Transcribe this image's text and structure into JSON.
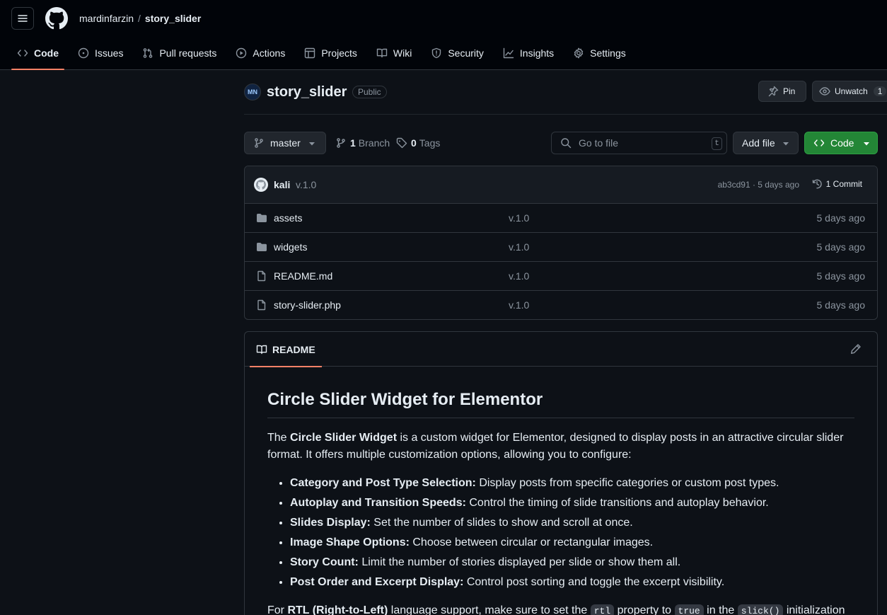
{
  "header": {
    "owner": "mardinfarzin",
    "separator": "/",
    "repo": "story_slider"
  },
  "nav": {
    "tabs": [
      {
        "label": "Code",
        "icon": "code-icon",
        "active": true
      },
      {
        "label": "Issues",
        "icon": "issue-icon"
      },
      {
        "label": "Pull requests",
        "icon": "pull-request-icon"
      },
      {
        "label": "Actions",
        "icon": "play-icon"
      },
      {
        "label": "Projects",
        "icon": "table-icon"
      },
      {
        "label": "Wiki",
        "icon": "book-icon"
      },
      {
        "label": "Security",
        "icon": "shield-icon"
      },
      {
        "label": "Insights",
        "icon": "graph-icon"
      },
      {
        "label": "Settings",
        "icon": "gear-icon"
      }
    ]
  },
  "repo_head": {
    "name": "story_slider",
    "org_avatar": "MN",
    "visibility": "Public",
    "pin_label": "Pin",
    "unwatch_label": "Unwatch",
    "watch_count": "1"
  },
  "toolbar": {
    "branch": "master",
    "branch_count": "1",
    "branch_label": "Branch",
    "tag_count": "0",
    "tag_label": "Tags",
    "goto_placeholder": "Go to file",
    "goto_key": "t",
    "add_file": "Add file",
    "code": "Code"
  },
  "commit": {
    "user": "kali",
    "message": "v.1.0",
    "hash_time": "ab3cd91 · 5 days ago",
    "count": "1 Commit"
  },
  "files": [
    {
      "name": "assets",
      "type": "folder",
      "message": "v.1.0",
      "date": "5 days ago"
    },
    {
      "name": "widgets",
      "type": "folder",
      "message": "v.1.0",
      "date": "5 days ago"
    },
    {
      "name": "README.md",
      "type": "file",
      "message": "v.1.0",
      "date": "5 days ago"
    },
    {
      "name": "story-slider.php",
      "type": "file",
      "message": "v.1.0",
      "date": "5 days ago"
    }
  ],
  "readme": {
    "tab": "README",
    "title": "Circle Slider Widget for Elementor",
    "intro_pre": "The ",
    "intro_bold": "Circle Slider Widget",
    "intro_post": " is a custom widget for Elementor, designed to display posts in an attractive circular slider format. It offers multiple customization options, allowing you to configure:",
    "features": [
      {
        "bold": "Category and Post Type Selection:",
        "text": " Display posts from specific categories or custom post types."
      },
      {
        "bold": "Autoplay and Transition Speeds:",
        "text": " Control the timing of slide transitions and autoplay behavior."
      },
      {
        "bold": "Slides Display:",
        "text": " Set the number of slides to show and scroll at once."
      },
      {
        "bold": "Image Shape Options:",
        "text": " Choose between circular or rectangular images."
      },
      {
        "bold": "Story Count:",
        "text": " Limit the number of stories displayed per slide or show them all."
      },
      {
        "bold": "Post Order and Excerpt Display:",
        "text": " Control post sorting and toggle the excerpt visibility."
      }
    ],
    "rtl_pre": "For ",
    "rtl_bold": "RTL (Right-to-Left)",
    "rtl_mid1": " language support, make sure to set the ",
    "rtl_code1": "rtl",
    "rtl_mid2": " property to ",
    "rtl_code2": "true",
    "rtl_mid3": " in the ",
    "rtl_code3": "slick()",
    "rtl_post": " initialization"
  }
}
